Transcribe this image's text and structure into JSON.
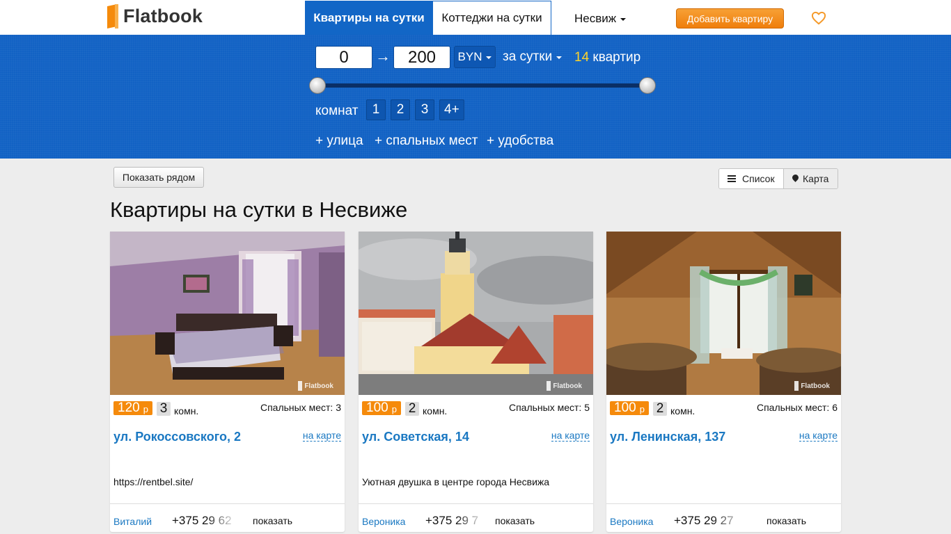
{
  "brand": {
    "name": "Flatbook"
  },
  "nav": {
    "tab_active": "Квартиры на сутки",
    "tab_inactive": "Коттеджи на сутки",
    "city": "Несвиж",
    "add_button": "Добавить квартиру"
  },
  "filters": {
    "price_min": "0",
    "price_arrow": "→",
    "price_max": "200",
    "currency": "BYN",
    "period": "за сутки",
    "count_number": "14",
    "count_label": "квартир",
    "slider_min_fraction": 0.0,
    "slider_max_fraction": 1.0,
    "rooms_label": "комнат",
    "rooms": [
      "1",
      "2",
      "3",
      "4+"
    ],
    "extras": [
      "+ улица",
      "+ спальных мест",
      "+ удобства"
    ]
  },
  "controls": {
    "show_near": "Показать рядом",
    "view_list": "Список",
    "view_map": "Карта"
  },
  "page_title": "Квартиры на сутки в Несвиже",
  "watermark": "Flatbook",
  "listings": [
    {
      "price": "120",
      "currency": "р",
      "rooms": "3",
      "rooms_unit": "комн.",
      "beds": "Спальных мест: 3",
      "street": "ул. Рокоссовского, 2",
      "on_map": "на карте",
      "description": "https://rentbel.site/",
      "owner": "Виталий",
      "phone": "+375 29 62",
      "show": "показать"
    },
    {
      "price": "100",
      "currency": "р",
      "rooms": "2",
      "rooms_unit": "комн.",
      "beds": "Спальных мест: 5",
      "street": "ул. Советская, 14",
      "on_map": "на карте",
      "description": "Уютная двушка в центре города Несвижа",
      "owner": "Вероника",
      "phone": "+375 29 7",
      "show": "показать"
    },
    {
      "price": "100",
      "currency": "р",
      "rooms": "2",
      "rooms_unit": "комн.",
      "beds": "Спальных мест: 6",
      "street": "ул. Ленинская, 137",
      "on_map": "на карте",
      "description": "",
      "owner": "Вероника",
      "phone": "+375 29 27",
      "show": "показать"
    }
  ],
  "colors": {
    "brand_blue": "#1266c6",
    "accent_orange": "#f58a0b",
    "link_blue": "#1a78c2",
    "count_yellow": "#ffd42a"
  }
}
